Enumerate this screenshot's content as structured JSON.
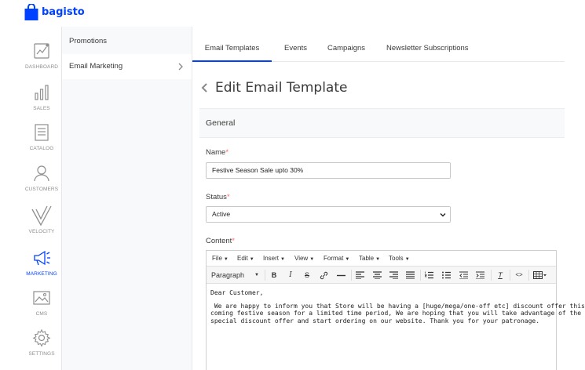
{
  "app": {
    "logo_text": "bagisto",
    "brand_color": "#0041ff"
  },
  "sidebar": {
    "items": [
      {
        "label": "DASHBOARD",
        "icon": "dashboard-icon"
      },
      {
        "label": "SALES",
        "icon": "sales-icon"
      },
      {
        "label": "CATALOG",
        "icon": "catalog-icon"
      },
      {
        "label": "CUSTOMERS",
        "icon": "customers-icon"
      },
      {
        "label": "VELOCITY",
        "icon": "velocity-icon"
      },
      {
        "label": "MARKETING",
        "icon": "megaphone-icon",
        "active": true
      },
      {
        "label": "CMS",
        "icon": "cms-icon"
      },
      {
        "label": "SETTINGS",
        "icon": "gear-icon"
      }
    ]
  },
  "subnav": {
    "items": [
      {
        "label": "Promotions"
      },
      {
        "label": "Email Marketing",
        "active": true
      }
    ]
  },
  "tabs": [
    {
      "label": "Email Templates",
      "active": true
    },
    {
      "label": "Events"
    },
    {
      "label": "Campaigns"
    },
    {
      "label": "Newsletter Subscriptions"
    }
  ],
  "page": {
    "title": "Edit Email Template"
  },
  "section": {
    "title": "General"
  },
  "form": {
    "name_label": "Name",
    "name_value": "Festive Season Sale upto 30%",
    "status_label": "Status",
    "status_value": "Active",
    "content_label": "Content",
    "required_mark": "*"
  },
  "editor": {
    "menu": [
      "File",
      "Edit",
      "Insert",
      "View",
      "Format",
      "Table",
      "Tools"
    ],
    "block_format": "Paragraph",
    "body": {
      "greeting": "Dear Customer,",
      "line1": " We are happy to inform you that Store will be having a [huge/mega/one-off etc] discount offer this",
      "line2": "coming festive season for a limited time period, We are hoping that you will take advantage of the new",
      "line3": "special discount offer and start ordering on our website. Thank you for your patronage."
    }
  }
}
